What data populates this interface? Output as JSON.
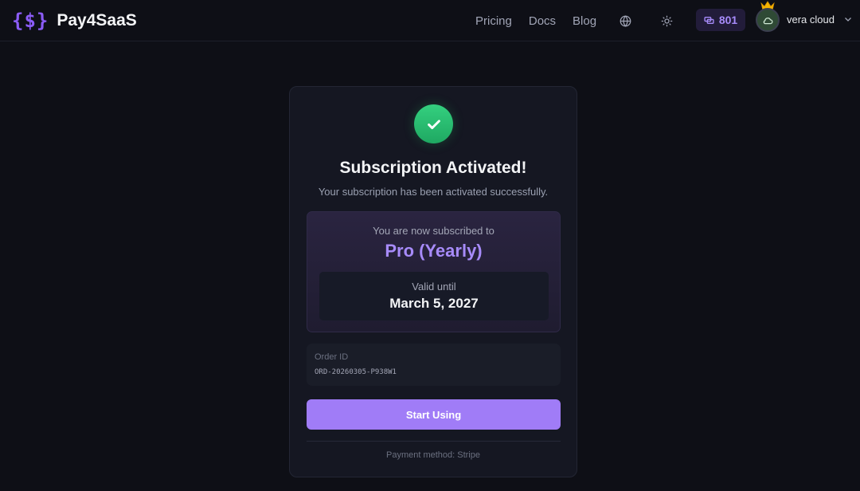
{
  "header": {
    "logo": "{$}",
    "brand": "Pay4SaaS",
    "nav": [
      "Pricing",
      "Docs",
      "Blog"
    ],
    "credits": "801",
    "user_name": "vera cloud"
  },
  "card": {
    "title": "Subscription Activated!",
    "subtitle": "Your subscription has been activated successfully.",
    "plan_label": "You are now subscribed to",
    "plan_name": "Pro (Yearly)",
    "valid_label": "Valid until",
    "valid_date": "March 5, 2027",
    "order_label": "Order ID",
    "order_id": "ORD-20260305-P938W1",
    "start_button": "Start Using",
    "payment_method": "Payment method: Stripe"
  },
  "colors": {
    "accent": "#a07cf7",
    "success": "#22c55e",
    "background": "#0e0f16"
  },
  "icons": [
    "globe-icon",
    "sun-icon",
    "credits-icon",
    "crown-icon",
    "cloud-icon",
    "chevron-down-icon",
    "check-icon"
  ]
}
